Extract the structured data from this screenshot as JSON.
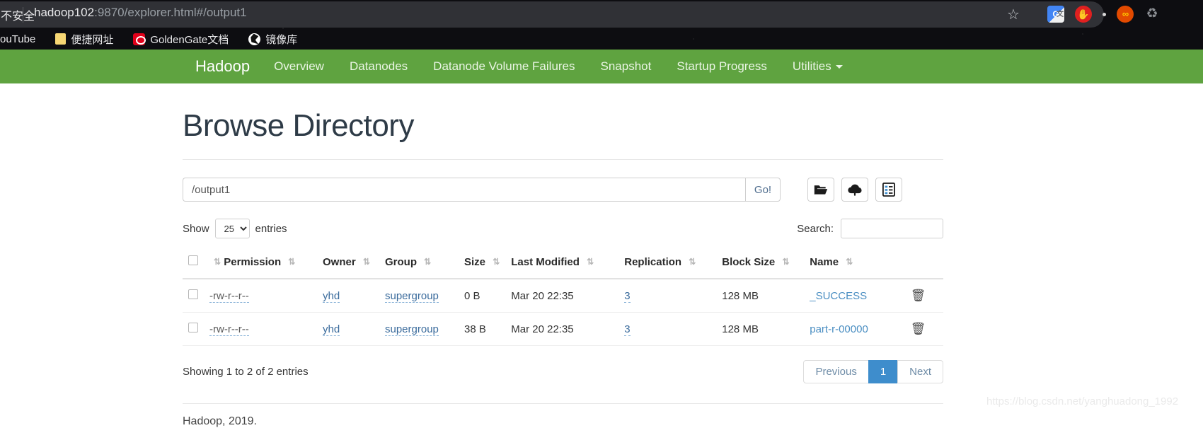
{
  "browser": {
    "security_label": "不安全",
    "url_host": "hadoop102",
    "url_rest": ":9870/explorer.html#/output1",
    "bookmarks": [
      {
        "label": "ouTube",
        "icon": "youtube-icon"
      },
      {
        "label": "便捷网址",
        "icon": "folder-icon"
      },
      {
        "label": "GoldenGate文档",
        "icon": "goldengate-icon"
      },
      {
        "label": "镜像库",
        "icon": "globe-icon"
      }
    ],
    "extensions": [
      "google-translate-icon",
      "adblock-hand-icon",
      "infinity-icon",
      "recycle-icon"
    ],
    "star_icon": "☆"
  },
  "navbar": {
    "brand": "Hadoop",
    "links": [
      {
        "label": "Overview"
      },
      {
        "label": "Datanodes"
      },
      {
        "label": "Datanode Volume Failures"
      },
      {
        "label": "Snapshot"
      },
      {
        "label": "Startup Progress"
      },
      {
        "label": "Utilities",
        "caret": true
      }
    ],
    "bg_color": "#5fa340"
  },
  "page": {
    "title": "Browse Directory",
    "path_value": "/output1",
    "go_label": "Go!",
    "buttons": [
      {
        "name": "new-directory-button",
        "icon": "folder-open-icon"
      },
      {
        "name": "upload-files-button",
        "icon": "cloud-upload-icon"
      },
      {
        "name": "cut-paste-button",
        "icon": "clipboard-list-icon"
      }
    ]
  },
  "table_controls": {
    "show_label": "Show",
    "entries_label": "entries",
    "page_length": "25",
    "page_length_options": [
      "25"
    ],
    "search_label": "Search:",
    "search_value": "",
    "search_placeholder": ""
  },
  "table": {
    "columns": [
      {
        "label": "",
        "name": "select-all"
      },
      {
        "label": "Permission",
        "name": "permission"
      },
      {
        "label": "Owner",
        "name": "owner"
      },
      {
        "label": "Group",
        "name": "group"
      },
      {
        "label": "Size",
        "name": "size"
      },
      {
        "label": "Last Modified",
        "name": "last-modified"
      },
      {
        "label": "Replication",
        "name": "replication"
      },
      {
        "label": "Block Size",
        "name": "block-size"
      },
      {
        "label": "Name",
        "name": "name"
      }
    ],
    "rows": [
      {
        "permission": "-rw-r--r--",
        "owner": "yhd",
        "group": "supergroup",
        "size": "0 B",
        "modified": "Mar 20 22:35",
        "replication": "3",
        "block_size": "128 MB",
        "name": "_SUCCESS"
      },
      {
        "permission": "-rw-r--r--",
        "owner": "yhd",
        "group": "supergroup",
        "size": "38 B",
        "modified": "Mar 20 22:35",
        "replication": "3",
        "block_size": "128 MB",
        "name": "part-r-00000"
      }
    ]
  },
  "table_footer": {
    "info": "Showing 1 to 2 of 2 entries",
    "previous_label": "Previous",
    "page_number": "1",
    "next_label": "Next",
    "active_color": "#3e8dcc"
  },
  "footer": {
    "copyright": "Hadoop, 2019.",
    "watermark": "https://blog.csdn.net/yanghuadong_1992"
  }
}
